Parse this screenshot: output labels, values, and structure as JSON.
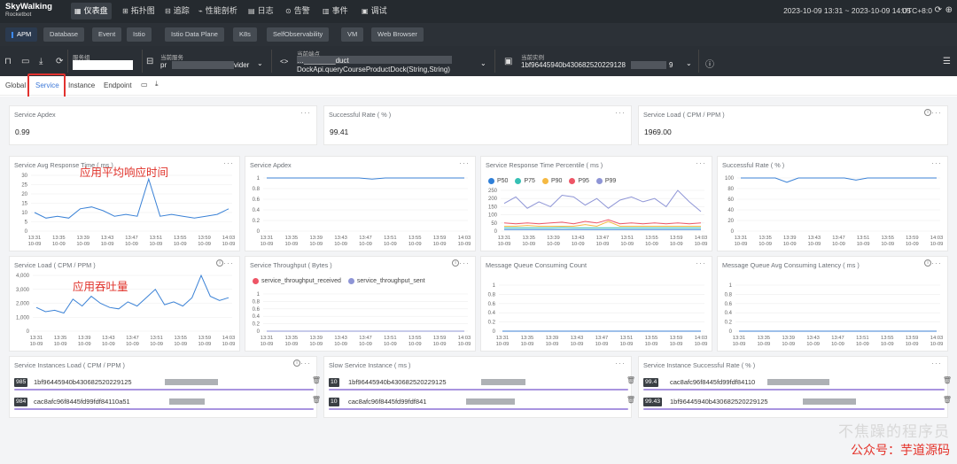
{
  "topbar": {
    "logo": "SkyWalking",
    "logo_sub": "Rocketbot",
    "nav": [
      {
        "label": "仪表盘",
        "icon": "▦",
        "active": true
      },
      {
        "label": "拓扑图",
        "icon": "⊞"
      },
      {
        "label": "追踪",
        "icon": "⊟"
      },
      {
        "label": "性能剖析",
        "icon": "⌁"
      },
      {
        "label": "日志",
        "icon": "▤"
      },
      {
        "label": "告警",
        "icon": "⊙"
      },
      {
        "label": "事件",
        "icon": "▥"
      },
      {
        "label": "调试",
        "icon": "▣"
      }
    ],
    "time_range": "2023-10-09 13:31 ~ 2023-10-09 14:05",
    "timezone": "UTC+8:0"
  },
  "layers": [
    "APM",
    "Database",
    "Event",
    "Istio",
    "Istio Data Plane",
    "K8s",
    "SelfObservability",
    "VM",
    "Web Browser"
  ],
  "selectors": {
    "group_label": "服务组",
    "service_label": "当前服务",
    "service_value_start": "pr",
    "service_value_end": "vider",
    "endpoint_label": "当前端点",
    "endpoint_value_line1": "…________duct",
    "endpoint_value_line2": "DockApi.queryCourseProductDock(String,String)",
    "instance_label": "当前实例",
    "instance_value": "1bf96445940b430682520229128",
    "instance_value_end": "9"
  },
  "tabs": [
    "Global",
    "Service",
    "Instance",
    "Endpoint"
  ],
  "cards": {
    "apdex": {
      "title": "Service Apdex",
      "value": "0.99"
    },
    "success": {
      "title": "Successful Rate ( % )",
      "value": "99.41"
    },
    "load": {
      "title": "Service Load ( CPM / PPM )",
      "value": "1969.00"
    },
    "avg_rt": {
      "title": "Service Avg Response Time ( ms )"
    },
    "apdex_chart": {
      "title": "Service Apdex"
    },
    "percentile": {
      "title": "Service Response Time Percentile ( ms )"
    },
    "success_chart": {
      "title": "Successful Rate ( % )"
    },
    "load_chart": {
      "title": "Service Load ( CPM / PPM )"
    },
    "throughput": {
      "title": "Service Throughput ( Bytes )",
      "legend": [
        {
          "label": "service_throughput_received",
          "color": "#ee5566"
        },
        {
          "label": "service_throughput_sent",
          "color": "#8e95d6"
        }
      ]
    },
    "mq_count": {
      "title": "Message Queue Consuming Count"
    },
    "mq_latency": {
      "title": "Message Queue Avg Consuming Latency ( ms )"
    },
    "inst_load": {
      "title": "Service Instances Load ( CPM / PPM )",
      "rows": [
        {
          "value": "985",
          "name": "1bf96445940b430682520229125"
        },
        {
          "value": "984",
          "name": "cac8afc96f8445fd99fdf84110a51"
        }
      ]
    },
    "slow_inst": {
      "title": "Slow Service Instance ( ms )",
      "rows": [
        {
          "value": "10",
          "name": "1bf96445940b430682520229125"
        },
        {
          "value": "10",
          "name": "cac8afc96f8445fd99fdf841"
        }
      ]
    },
    "inst_success": {
      "title": "Service Instance Successful Rate ( % )",
      "rows": [
        {
          "value": "99.4",
          "name": "cac8afc96f8445fd99fdf84110"
        },
        {
          "value": "99.43",
          "name": "1bf96445940b430682520229125"
        }
      ]
    }
  },
  "annotations": {
    "avg_rt": "应用平均响应时间",
    "load": "应用吞吐量"
  },
  "watermark": {
    "line1": "不焦躁的程序员",
    "line2": "公众号：芋道源码"
  },
  "chart_data": [
    {
      "type": "line",
      "title": "Service Avg Response Time ( ms )",
      "x": [
        "13:31",
        "13:33",
        "13:35",
        "13:37",
        "13:39",
        "13:41",
        "13:43",
        "13:45",
        "13:47",
        "13:49",
        "13:51",
        "13:53",
        "13:55",
        "13:57",
        "13:59",
        "14:01",
        "14:03"
      ],
      "series": [
        {
          "values": [
            10,
            7,
            8,
            7,
            12,
            13,
            11,
            8,
            9,
            8,
            28,
            8,
            9,
            8,
            7,
            8,
            9,
            12
          ]
        }
      ],
      "ylim": [
        0,
        30
      ],
      "yticks": [
        0,
        5,
        10,
        15,
        20,
        25,
        30
      ]
    },
    {
      "type": "line",
      "title": "Service Apdex",
      "yticks": [
        0,
        0.2,
        0.4,
        0.6,
        0.8,
        1
      ],
      "series": [
        {
          "values": [
            1,
            1,
            1,
            1,
            1,
            1,
            1,
            1,
            0.98,
            1,
            1,
            1,
            1,
            1,
            1,
            1
          ]
        }
      ]
    },
    {
      "type": "line",
      "title": "Service Response Time Percentile ( ms )",
      "yticks": [
        0,
        50,
        100,
        150,
        200,
        250
      ],
      "series": [
        {
          "name": "P50",
          "values": [
            10,
            10,
            10,
            10,
            10,
            10,
            10,
            10,
            10,
            10,
            10,
            10,
            10,
            10,
            10,
            10,
            10,
            10
          ]
        },
        {
          "name": "P75",
          "values": [
            20,
            20,
            20,
            20,
            20,
            22,
            20,
            20,
            20,
            20,
            20,
            20,
            20,
            20,
            20,
            20,
            20,
            20
          ]
        },
        {
          "name": "P90",
          "values": [
            30,
            30,
            35,
            30,
            30,
            30,
            30,
            40,
            30,
            60,
            30,
            30,
            30,
            30,
            30,
            30,
            30,
            30
          ]
        },
        {
          "name": "P95",
          "values": [
            50,
            45,
            50,
            45,
            50,
            55,
            45,
            60,
            50,
            70,
            45,
            50,
            45,
            50,
            45,
            50,
            45,
            50
          ]
        },
        {
          "name": "P99",
          "values": [
            170,
            210,
            140,
            180,
            150,
            220,
            210,
            160,
            200,
            140,
            190,
            210,
            180,
            200,
            150,
            250,
            180,
            120
          ]
        }
      ]
    },
    {
      "type": "line",
      "title": "Successful Rate ( % )",
      "yticks": [
        0,
        20,
        40,
        60,
        80,
        100
      ],
      "series": [
        {
          "values": [
            100,
            100,
            100,
            100,
            92,
            100,
            100,
            100,
            100,
            100,
            96,
            100,
            100,
            100,
            100,
            100,
            100,
            100
          ]
        }
      ]
    },
    {
      "type": "line",
      "title": "Service Load ( CPM / PPM )",
      "yticks": [
        0,
        1000,
        2000,
        3000,
        4000
      ],
      "series": [
        {
          "values": [
            1700,
            1400,
            1500,
            1300,
            2300,
            1800,
            2500,
            2000,
            1700,
            1600,
            2100,
            1800,
            2400,
            3000,
            1900,
            2100,
            1800,
            2400,
            4000,
            2500,
            2200,
            2400
          ]
        }
      ]
    },
    {
      "type": "line",
      "title": "Service Throughput ( Bytes )",
      "yticks": [
        0,
        0.2,
        0.4,
        0.6,
        0.8,
        1
      ]
    },
    {
      "type": "line",
      "title": "Message Queue Consuming Count",
      "yticks": [
        0,
        0.2,
        0.4,
        0.6,
        0.8,
        1
      ]
    },
    {
      "type": "line",
      "title": "Message Queue Avg Consuming Latency ( ms )",
      "yticks": [
        0,
        0.2,
        0.4,
        0.6,
        0.8,
        1
      ]
    }
  ]
}
